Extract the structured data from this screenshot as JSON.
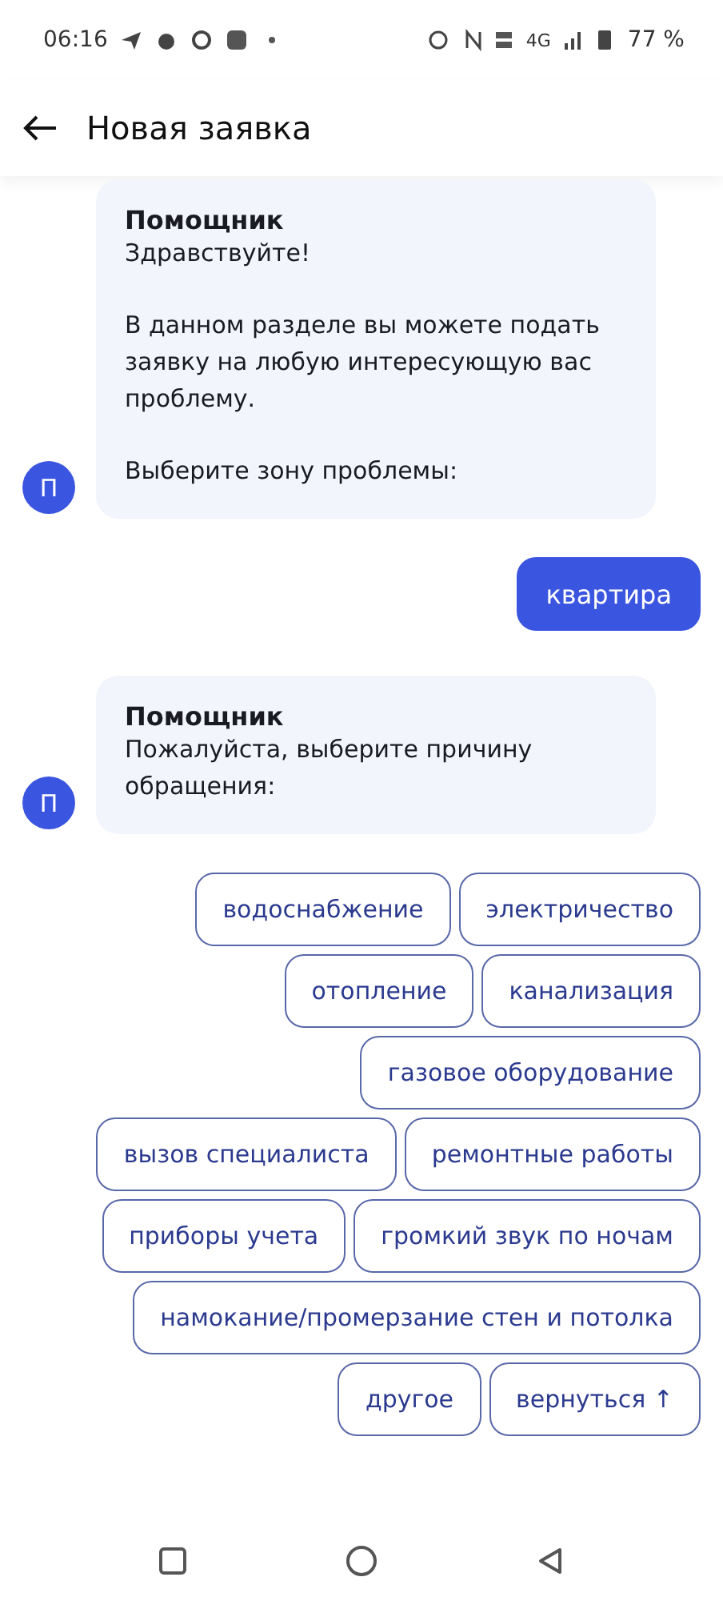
{
  "status_bar": {
    "time": "06:16",
    "network": "4G",
    "battery": "77 %"
  },
  "header": {
    "title": "Новая заявка"
  },
  "messages": [
    {
      "kind": "bot",
      "author": "Помощник",
      "avatar": "П",
      "paragraphs": [
        "Здравствуйте!",
        "В данном разделе вы можете подать заявку на любую интересующую вас проблему.",
        "Выберите зону проблемы:"
      ]
    },
    {
      "kind": "user",
      "text": "квартира"
    },
    {
      "kind": "bot",
      "author": "Помощник",
      "avatar": "П",
      "paragraphs": [
        "Пожалуйста, выберите причину обращения:"
      ]
    }
  ],
  "option_rows": [
    [
      "водоснабжение",
      "электричество"
    ],
    [
      "отопление",
      "канализация"
    ],
    [
      "газовое оборудование"
    ],
    [
      "вызов специалиста",
      "ремонтные работы"
    ],
    [
      "приборы учета",
      "громкий звук по ночам"
    ],
    [
      "намокание/промерзание стен и потолка"
    ],
    [
      "другое",
      "вернуться ↑"
    ]
  ]
}
